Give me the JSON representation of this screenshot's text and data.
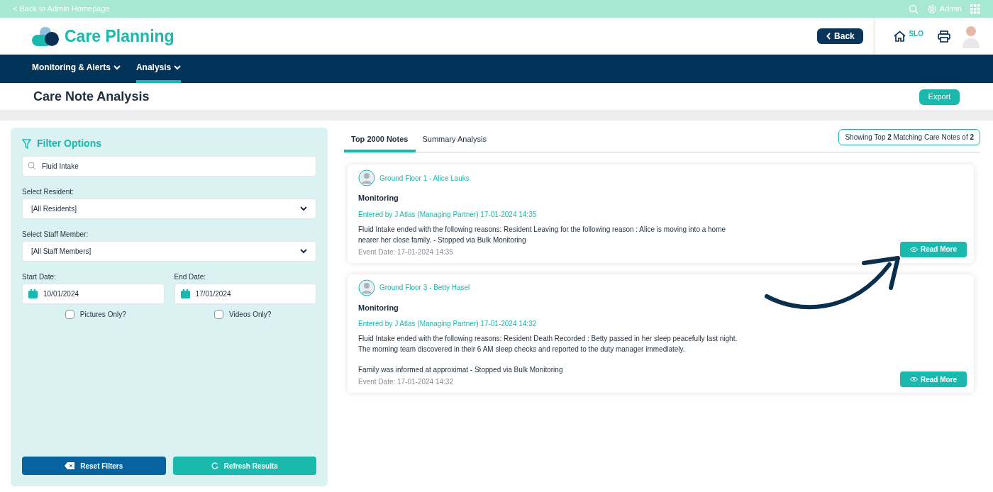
{
  "top_bar": {
    "back_link": "< Back to Admin Homepage",
    "user": "Admin"
  },
  "header": {
    "app_name": "Care Planning",
    "back_button": "Back",
    "home_label": "SLO"
  },
  "nav": [
    {
      "label": "Monitoring & Alerts",
      "selected": false
    },
    {
      "label": "Analysis",
      "selected": true
    }
  ],
  "page": {
    "title": "Care Note Analysis",
    "export_button": "Export"
  },
  "filters": {
    "title": "Filter Options",
    "search_value": "Fluid Intake",
    "resident_label": "Select Resident:",
    "resident_value": "[All Residents]",
    "staff_label": "Select Staff Member:",
    "staff_value": "[All Staff Members]",
    "start_label": "Start Date:",
    "start_value": "10/01/2024",
    "end_label": "End Date:",
    "end_value": "17/01/2024",
    "checkboxes": [
      {
        "label": "Pictures Only?",
        "checked": false
      },
      {
        "label": "Videos Only?",
        "checked": false
      }
    ],
    "reset_button": "Reset Filters",
    "refresh_button": "Refresh Results"
  },
  "tabs": [
    {
      "label": "Top 2000 Notes",
      "selected": true
    },
    {
      "label": "Summary Analysis",
      "selected": false
    }
  ],
  "result_count": "Showing Top **2** Matching Care Notes of **2**",
  "notes": [
    {
      "resident": "Ground Floor 1 - Alice Lauks",
      "type": "Monitoring",
      "entered_by": "Entered by J Atlas (Managing Partner) 17-01-2024 14:35",
      "body": [
        [
          "Fluid Intake ended with the following reasons: Resident Leaving for the following reason : Alice is moving into a home",
          "nearer her close family. - Stopped via Bulk Monitoring"
        ]
      ],
      "event_date": "Event Date: 17-01-2024 14:35",
      "button": "Read More"
    },
    {
      "resident": "Ground Floor 3 - Betty Hasel",
      "type": "Monitoring",
      "entered_by": "Entered by J Atlas (Managing Partner) 17-01-2024 14:32",
      "body": [
        [
          "Fluid Intake ended with the following reasons: Resident Death Recorded : Betty passed in her sleep peacefully last night.",
          "The morning team discovered in their 6 AM sleep checks and reported to the duty manager immediately."
        ],
        [
          "Family was informed at approximat - Stopped via Bulk Monitoring"
        ]
      ],
      "event_date": "Event Date: 17-01-2024 14:32",
      "button": "Read More"
    }
  ]
}
